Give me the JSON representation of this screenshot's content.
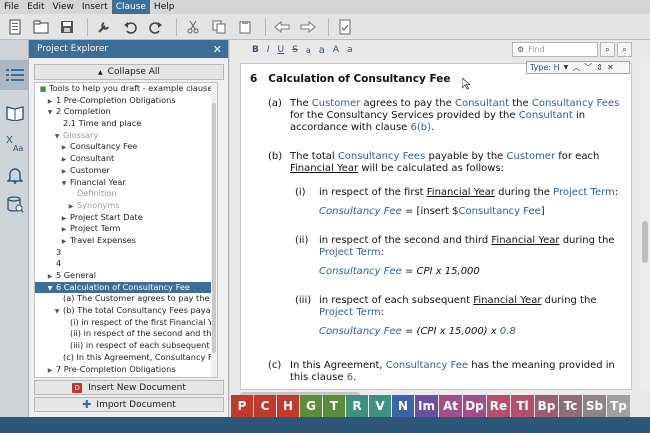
{
  "menu": [
    "File",
    "Edit",
    "View",
    "Insert",
    "Clause",
    "Help"
  ],
  "menu_active": "Clause",
  "explorer": {
    "title": "Project Explorer",
    "collapse_label": "Collapse All",
    "insert_label": "Insert New Document",
    "import_label": "Import Document",
    "tree": [
      {
        "indent": 0,
        "tw": "■",
        "label": "Tools to help you draft - example clauses"
      },
      {
        "indent": 1,
        "tw": "▶",
        "label": "1  Pre-Completion Obligations"
      },
      {
        "indent": 1,
        "tw": "▼",
        "label": "2  Completion"
      },
      {
        "indent": 2,
        "tw": "",
        "label": "2.1  Time and place"
      },
      {
        "indent": 2,
        "tw": "▼",
        "label": "Glossary",
        "grey": true
      },
      {
        "indent": 3,
        "tw": "▶",
        "label": "Consultancy Fee"
      },
      {
        "indent": 3,
        "tw": "▶",
        "label": "Consultant"
      },
      {
        "indent": 3,
        "tw": "▶",
        "label": "Customer"
      },
      {
        "indent": 3,
        "tw": "▼",
        "label": "Financial Year"
      },
      {
        "indent": 4,
        "tw": "",
        "label": "Definition",
        "grey": true
      },
      {
        "indent": 4,
        "tw": "▶",
        "label": "Synonyms",
        "grey": true
      },
      {
        "indent": 3,
        "tw": "▶",
        "label": "Project Start Date"
      },
      {
        "indent": 3,
        "tw": "▶",
        "label": "Project Term"
      },
      {
        "indent": 3,
        "tw": "▶",
        "label": "Travel Expenses"
      },
      {
        "indent": 1,
        "tw": "",
        "label": "3"
      },
      {
        "indent": 1,
        "tw": "",
        "label": "4"
      },
      {
        "indent": 1,
        "tw": "▶",
        "label": "5  General"
      },
      {
        "indent": 1,
        "tw": "▼",
        "label": "6  Calculation of Consultancy Fee",
        "sel": true
      },
      {
        "indent": 2,
        "tw": "",
        "label": "(a)  The Customer agrees to pay the Co..."
      },
      {
        "indent": 2,
        "tw": "▼",
        "label": "(b)  The total Consultancy Fees payable..."
      },
      {
        "indent": 3,
        "tw": "",
        "label": "(i)  in respect of the first Financial Yea..."
      },
      {
        "indent": 3,
        "tw": "",
        "label": "(ii)  in respect of the second and third..."
      },
      {
        "indent": 3,
        "tw": "",
        "label": "(iii)  in respect of each subsequent Fi..."
      },
      {
        "indent": 2,
        "tw": "",
        "label": "(c)  In this Agreement, Consultancy Fee..."
      },
      {
        "indent": 1,
        "tw": "▶",
        "label": "7  Pre-Completion Obligations"
      }
    ]
  },
  "editor": {
    "fmt": [
      "B",
      "I",
      "U",
      "S",
      "a",
      "a",
      "A",
      "a"
    ],
    "find_placeholder": "Find",
    "findbar_label": "Type: H"
  },
  "doc": {
    "heading_num": "6",
    "heading": "Calculation of Consultancy Fee",
    "a_label": "(a)",
    "b_label": "(b)",
    "c_label": "(c)",
    "i_label": "(i)",
    "ii_label": "(ii)",
    "iii_label": "(iii)",
    "a1_1": "The ",
    "a1_2": "Customer",
    "a1_3": " agrees to pay the ",
    "a1_4": "Consultant",
    "a1_5": " the ",
    "a1_6": "Consultancy Fees",
    "a2_1": "for the Consultancy Services provided by the ",
    "a2_2": "Consultant",
    "a2_3": " in",
    "a3_1": "accordance with clause ",
    "a3_2": "6(b)",
    "a3_3": ".",
    "b1_1": "The total ",
    "b1_2": "Consultancy Fees",
    "b1_3": " payable by the ",
    "b1_4": "Customer",
    "b1_5": " for each",
    "b2_1": "Financial Year",
    "b2_2": " will be calculated as follows:",
    "i1_1": "in respect of the first ",
    "i1_2": "Financial Year",
    "i1_3": " during the ",
    "i1_4": "Project Term",
    "i1_5": ":",
    "i2_1": "Consultancy Fee",
    "i2_2": " = [insert $",
    "i2_3": "Consultancy Fee",
    "i2_4": "]",
    "ii1_1": "in respect of the second and third ",
    "ii1_2": "Financial Year",
    "ii1_3": " during the",
    "ii2_1": "Project Term",
    "ii2_2": ":",
    "ii3_1": "Consultancy Fee",
    "ii3_2": " = CPI x 15,000",
    "iii1_1": "in respect of each subsequent ",
    "iii1_2": "Financial Year",
    "iii1_3": " during the",
    "iii2_1": "Project Term",
    "iii2_2": ":",
    "iii3_1": "Consultancy Fee",
    "iii3_2": " = (CPI x 15,000) x ",
    "iii3_3": "0.8",
    "c1_1": "In this Agreement, ",
    "c1_2": "Consultancy Fee",
    "c1_3": " has the meaning provided in",
    "c2_1": "this clause ",
    "c2_2": "6",
    "c2_3": "."
  },
  "tiles": [
    {
      "label": "P",
      "color": "#c0392b"
    },
    {
      "label": "C",
      "color": "#c0392b"
    },
    {
      "label": "H",
      "color": "#c0392b"
    },
    {
      "label": "G",
      "color": "#5b8c3a"
    },
    {
      "label": "T",
      "color": "#5b8c3a"
    },
    {
      "label": "R",
      "color": "#3f9080"
    },
    {
      "label": "V",
      "color": "#3f9080"
    },
    {
      "label": "N",
      "color": "#3d62a8"
    },
    {
      "label": "Im",
      "color": "#6a4fa0"
    },
    {
      "label": "At",
      "color": "#a04f8a"
    },
    {
      "label": "Dp",
      "color": "#a04f8a"
    },
    {
      "label": "Re",
      "color": "#b4506a"
    },
    {
      "label": "Tl",
      "color": "#b4506a"
    },
    {
      "label": "Bp",
      "color": "#9c5d6e"
    },
    {
      "label": "Tc",
      "color": "#8d6f7a"
    },
    {
      "label": "Sb",
      "color": "#8d8388"
    },
    {
      "label": "Tp",
      "color": "#a39ea0"
    }
  ]
}
